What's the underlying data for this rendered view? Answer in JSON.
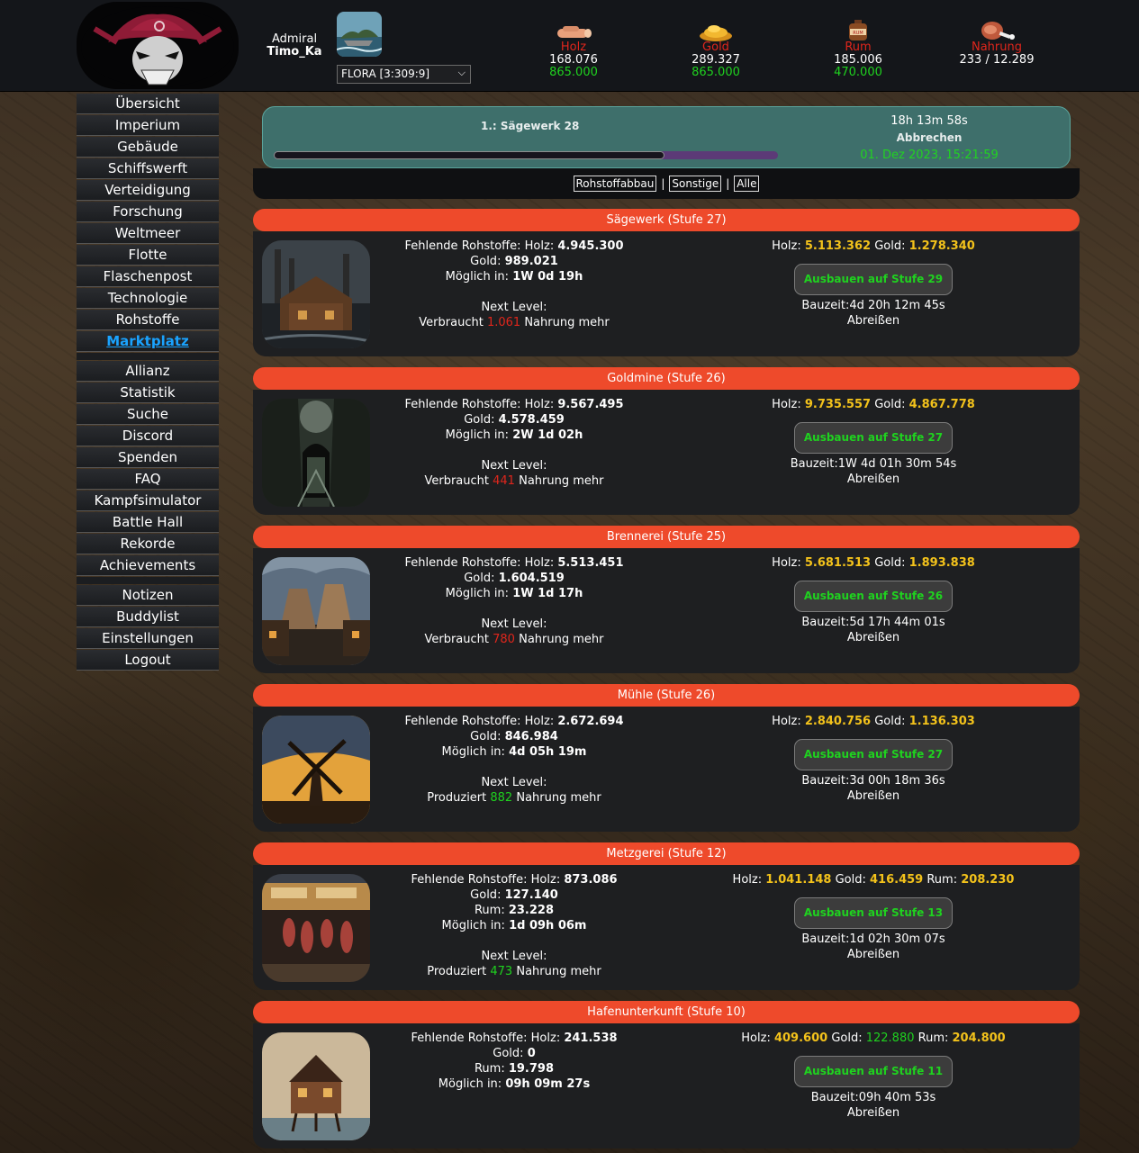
{
  "player": {
    "rank": "Admiral",
    "name": "Timo_Ka"
  },
  "planet_select": {
    "value": "FLORA [3:309:9]"
  },
  "resources": [
    {
      "name": "Holz",
      "amount": "168.076",
      "max": "865.000",
      "icon": "wood-icon"
    },
    {
      "name": "Gold",
      "amount": "289.327",
      "max": "865.000",
      "icon": "gold-icon"
    },
    {
      "name": "Rum",
      "amount": "185.006",
      "max": "470.000",
      "icon": "rum-icon"
    },
    {
      "name": "Nahrung",
      "amount": "233 / 12.289",
      "max": "",
      "icon": "meat-icon"
    }
  ],
  "nav": {
    "group1": [
      "Übersicht",
      "Imperium",
      "Gebäude",
      "Schiffswerft",
      "Verteidigung",
      "Forschung",
      "Weltmeer",
      "Flotte",
      "Flaschenpost",
      "Technologie",
      "Rohstoffe",
      "Marktplatz"
    ],
    "group2": [
      "Allianz",
      "Statistik",
      "Suche",
      "Discord",
      "Spenden",
      "FAQ",
      "Kampfsimulator",
      "Battle Hall",
      "Rekorde",
      "Achievements"
    ],
    "group3": [
      "Notizen",
      "Buddylist",
      "Einstellungen",
      "Logout"
    ],
    "active": "Marktplatz"
  },
  "queue": {
    "item": "1.:  Sägewerk 28",
    "remaining": "18h 13m 58s",
    "cancel": "Abbrechen",
    "finish": "01. Dez 2023, 15:21:59",
    "progress": 0.775
  },
  "filters": [
    "Rohstoffabbau",
    "Sonstige",
    "Alle"
  ],
  "labels": {
    "missing": "Fehlende Rohstoffe:",
    "possible": "Möglich in:",
    "next_level": "Next Level:",
    "buildtime": "Bauzeit:",
    "demolish": "Abreißen"
  },
  "buildings": [
    {
      "title": "Sägewerk (Stufe 27)",
      "missing": [
        {
          "res": "Holz",
          "val": "4.945.300"
        },
        {
          "res": "Gold",
          "val": "989.021"
        }
      ],
      "possible": "1W 0d 19h",
      "effect": {
        "pre": "Verbraucht",
        "val": "1.061",
        "post": "Nahrung mehr",
        "color": "red"
      },
      "cost": [
        {
          "res": "Holz",
          "val": "5.113.362",
          "color": "yellow"
        },
        {
          "res": "Gold",
          "val": "1.278.340",
          "color": "yellow"
        }
      ],
      "button": "Ausbauen auf Stufe 29",
      "buildtime": "4d 20h 12m 45s"
    },
    {
      "title": "Goldmine (Stufe 26)",
      "missing": [
        {
          "res": "Holz",
          "val": "9.567.495"
        },
        {
          "res": "Gold",
          "val": "4.578.459"
        }
      ],
      "possible": "2W 1d 02h",
      "effect": {
        "pre": "Verbraucht",
        "val": "441",
        "post": "Nahrung mehr",
        "color": "red"
      },
      "cost": [
        {
          "res": "Holz",
          "val": "9.735.557",
          "color": "yellow"
        },
        {
          "res": "Gold",
          "val": "4.867.778",
          "color": "yellow"
        }
      ],
      "button": "Ausbauen auf Stufe 27",
      "buildtime": "1W 4d 01h 30m 54s"
    },
    {
      "title": "Brennerei (Stufe 25)",
      "missing": [
        {
          "res": "Holz",
          "val": "5.513.451"
        },
        {
          "res": "Gold",
          "val": "1.604.519"
        }
      ],
      "possible": "1W 1d 17h",
      "effect": {
        "pre": "Verbraucht",
        "val": "780",
        "post": "Nahrung mehr",
        "color": "red"
      },
      "cost": [
        {
          "res": "Holz",
          "val": "5.681.513",
          "color": "yellow"
        },
        {
          "res": "Gold",
          "val": "1.893.838",
          "color": "yellow"
        }
      ],
      "button": "Ausbauen auf Stufe 26",
      "buildtime": "5d 17h 44m 01s"
    },
    {
      "title": "Mühle (Stufe 26)",
      "missing": [
        {
          "res": "Holz",
          "val": "2.672.694"
        },
        {
          "res": "Gold",
          "val": "846.984"
        }
      ],
      "possible": "4d 05h 19m",
      "effect": {
        "pre": "Produziert",
        "val": "882",
        "post": "Nahrung mehr",
        "color": "green"
      },
      "cost": [
        {
          "res": "Holz",
          "val": "2.840.756",
          "color": "yellow"
        },
        {
          "res": "Gold",
          "val": "1.136.303",
          "color": "yellow"
        }
      ],
      "button": "Ausbauen auf Stufe 27",
      "buildtime": "3d 00h 18m 36s"
    },
    {
      "title": "Metzgerei (Stufe 12)",
      "missing": [
        {
          "res": "Holz",
          "val": "873.086"
        },
        {
          "res": "Gold",
          "val": "127.140"
        },
        {
          "res": "Rum",
          "val": "23.228"
        }
      ],
      "possible": "1d 09h 06m",
      "effect": {
        "pre": "Produziert",
        "val": "473",
        "post": "Nahrung mehr",
        "color": "green"
      },
      "cost": [
        {
          "res": "Holz",
          "val": "1.041.148",
          "color": "yellow"
        },
        {
          "res": "Gold",
          "val": "416.459",
          "color": "yellow"
        },
        {
          "res": "Rum",
          "val": "208.230",
          "color": "yellow"
        }
      ],
      "button": "Ausbauen auf Stufe 13",
      "buildtime": "1d 02h 30m 07s"
    },
    {
      "title": "Hafenunterkunft (Stufe 10)",
      "missing": [
        {
          "res": "Holz",
          "val": "241.538"
        },
        {
          "res": "Gold",
          "val": "0"
        },
        {
          "res": "Rum",
          "val": "19.798"
        }
      ],
      "possible": "09h 09m 27s",
      "effect": null,
      "cost": [
        {
          "res": "Holz",
          "val": "409.600",
          "color": "yellow"
        },
        {
          "res": "Gold",
          "val": "122.880",
          "color": "green"
        },
        {
          "res": "Rum",
          "val": "204.800",
          "color": "yellow"
        }
      ],
      "button": "Ausbauen auf Stufe 11",
      "buildtime": "09h 40m 53s"
    }
  ]
}
